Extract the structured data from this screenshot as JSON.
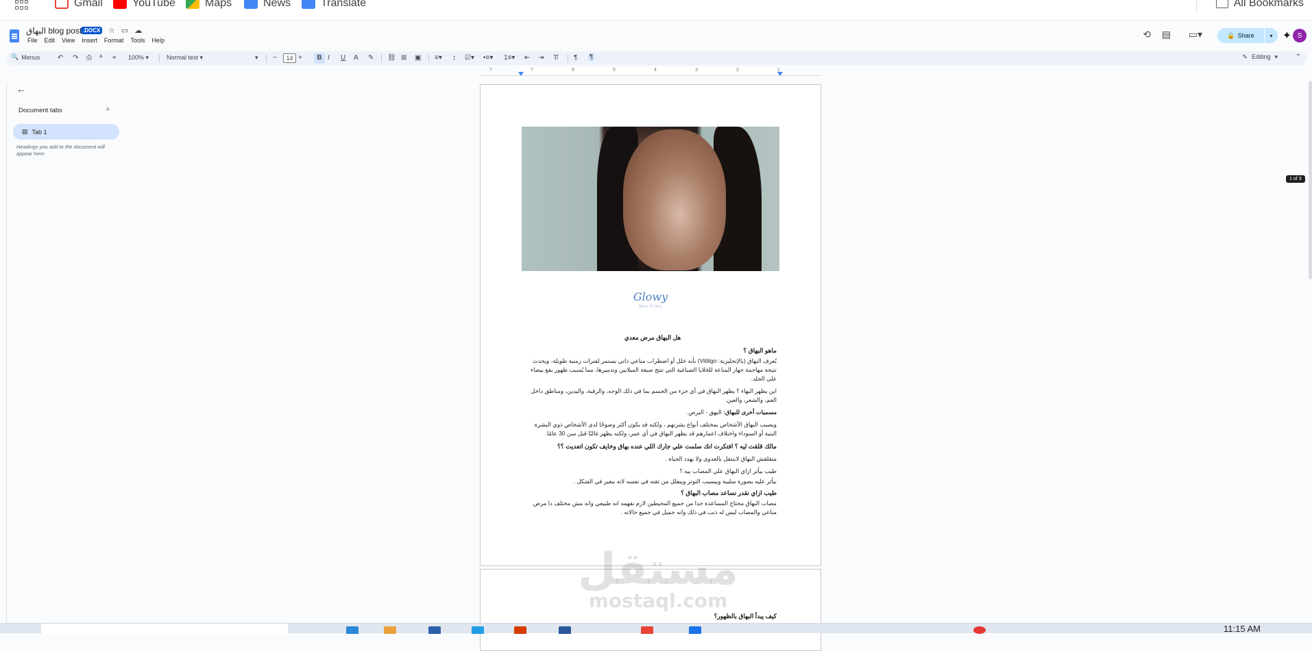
{
  "bookmarks": {
    "items": [
      {
        "label": "Gmail",
        "color": "#ea4335"
      },
      {
        "label": "YouTube",
        "color": "#ff0000"
      },
      {
        "label": "Maps",
        "color": "#34a853"
      },
      {
        "label": "News",
        "color": "#4285f4"
      },
      {
        "label": "Translate",
        "color": "#4285f4"
      }
    ],
    "all_bookmarks": "All Bookmarks"
  },
  "doc": {
    "title": "البهاق blog post",
    "badge": ".DOCX",
    "menus": [
      "File",
      "Edit",
      "View",
      "Insert",
      "Format",
      "Tools",
      "Help"
    ],
    "share_label": "Share",
    "avatar_letter": "S"
  },
  "toolbar": {
    "search_label": "Menus",
    "zoom": "100%",
    "style": "Normal text",
    "font_size": "14",
    "mode": "Editing"
  },
  "ruler": {
    "numbers": [
      "7",
      "6",
      "5",
      "4",
      "3",
      "2",
      "1"
    ]
  },
  "sidebar": {
    "header": "Document tabs",
    "tab_label": "Tab 1",
    "hint": "Headings you add to the document will appear here."
  },
  "page": {
    "logo_main": "Glowy",
    "logo_sub": "Skin Clinic",
    "heading": "هل البهاق مرض معدي",
    "q1": "ماهو البهاق ؟",
    "p1": "يُعرف البهاق (بالإنجليزية: Vitiligo) بأنه خلل أو اضطراب مناعي ذاتي يستمر لفترات زمنية طويلة، ويحدث نتيجة مهاجمة جهاز المناعة للخلايا الصباغية التي تنتج صبغة الميلانين وتدميرها، مما يُسبب ظهور بقع بيضاء على الجلد.",
    "p2": "اين يظهر البهاء ؟ يظهر البهاق في أي جزء من الجسم بما في ذلك الوجه، والرقبة، واليدين، ومناطق داخل الفم، والشعر، والعين.",
    "q2": "مسميات أخرى للبهاق:",
    "q2_rest": " البهق - البرص.",
    "p3": "ويصيب البهاق الأشخاص بمختلف أنواع بشرتهم ، ولكنه قد يكون أكثر وضوحًا لدى الأشخاص ذوي البشرة البنية أو السوداء واختلاف اعمارهم قد يظهر البهاق في أي عمر، ولكنه يظهر غالبًا قبل سن 30 عامًا.",
    "q3": "مالك قلقت ليه ؟ افتكرت انك سلمت علي جارك اللي عنده بهاق وخايف تكون اتعديت ؟؟",
    "p4": "متقلقش البهاق لاينتقل بالعدوى ولا يهدد الحياة .",
    "p5": "طيب بيأثر ازاي البهاق علي المصاب بيه ؟",
    "p6": "بيأثر عليه بصورة سلبية وبيسبب التوتر وبيقلل من ثقته في نفسه لانه بيغير في الشكل .",
    "q4": "طيب ازاي نقدر نساعد مصاب البهاق ؟",
    "p7": "مصاب البهاق محتاج المساعدة جدا من جميع المحيطين لازم نفهمه انه طبيعي وانه مش مختلف دا مرض مناعي والمصاب ليس له ذنب في ذلك وانه جميل في جميع حالاته ."
  },
  "page2": {
    "heading": "كيف يبدأ البهاق بالظهور؟"
  },
  "watermark": {
    "arabic": "مستقل",
    "latin": "mostaql.com"
  },
  "page_indicator": "1 of 3",
  "taskbar": {
    "clock": "11:15 AM"
  }
}
